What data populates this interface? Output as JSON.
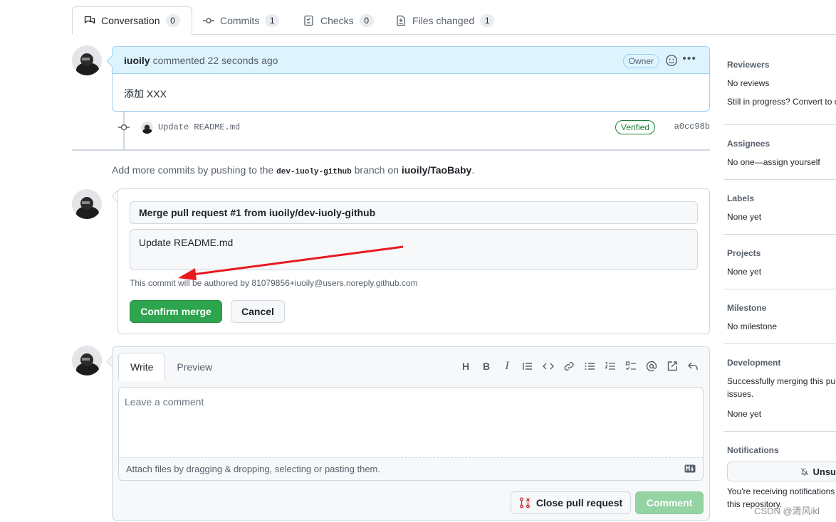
{
  "tabs": [
    {
      "label": "Conversation",
      "count": "0",
      "icon": "conversation-icon"
    },
    {
      "label": "Commits",
      "count": "1",
      "icon": "commit-icon"
    },
    {
      "label": "Checks",
      "count": "0",
      "icon": "checks-icon"
    },
    {
      "label": "Files changed",
      "count": "1",
      "icon": "file-diff-icon"
    }
  ],
  "comment": {
    "author": "iuoily",
    "meta": "commented 22 seconds ago",
    "badge": "Owner",
    "body": "添加 XXX"
  },
  "commit": {
    "message": "Update README.md",
    "verified": "Verified",
    "sha": "a0cc98b"
  },
  "info": {
    "prefix": "Add more commits by pushing to the",
    "branch": "dev-iuoly-github",
    "middle": "branch on",
    "repo": "iuoily/TaoBaby",
    "suffix": "."
  },
  "merge": {
    "title": "Merge pull request #1 from iuoily/dev-iuoly-github",
    "body": "Update README.md",
    "note": "This commit will be authored by 81079856+iuoily@users.noreply.github.com",
    "confirm": "Confirm merge",
    "cancel": "Cancel"
  },
  "editor": {
    "tab_write": "Write",
    "tab_preview": "Preview",
    "placeholder": "Leave a comment",
    "attach": "Attach files by dragging & dropping, selecting or pasting them.",
    "close_pr": "Close pull request",
    "comment": "Comment"
  },
  "sidebar": {
    "reviewers": {
      "title": "Reviewers",
      "line1": "No reviews",
      "line2": "Still in progress? Convert to d"
    },
    "assignees": {
      "title": "Assignees",
      "line1": "No one—assign yourself"
    },
    "labels": {
      "title": "Labels",
      "line1": "None yet"
    },
    "projects": {
      "title": "Projects",
      "line1": "None yet"
    },
    "milestone": {
      "title": "Milestone",
      "line1": "No milestone"
    },
    "development": {
      "title": "Development",
      "line1": "Successfully merging this pul",
      "line2": "issues.",
      "line3": "None yet"
    },
    "notifications": {
      "title": "Notifications",
      "button": "Unsu",
      "line1": "You're receiving notifications",
      "line2": "this repository."
    }
  },
  "watermark": "CSDN @清风ikl",
  "colors": {
    "accent_blue": "#ddf4ff",
    "merge_green": "#2da44e",
    "arrow_red": "#e8191f"
  }
}
